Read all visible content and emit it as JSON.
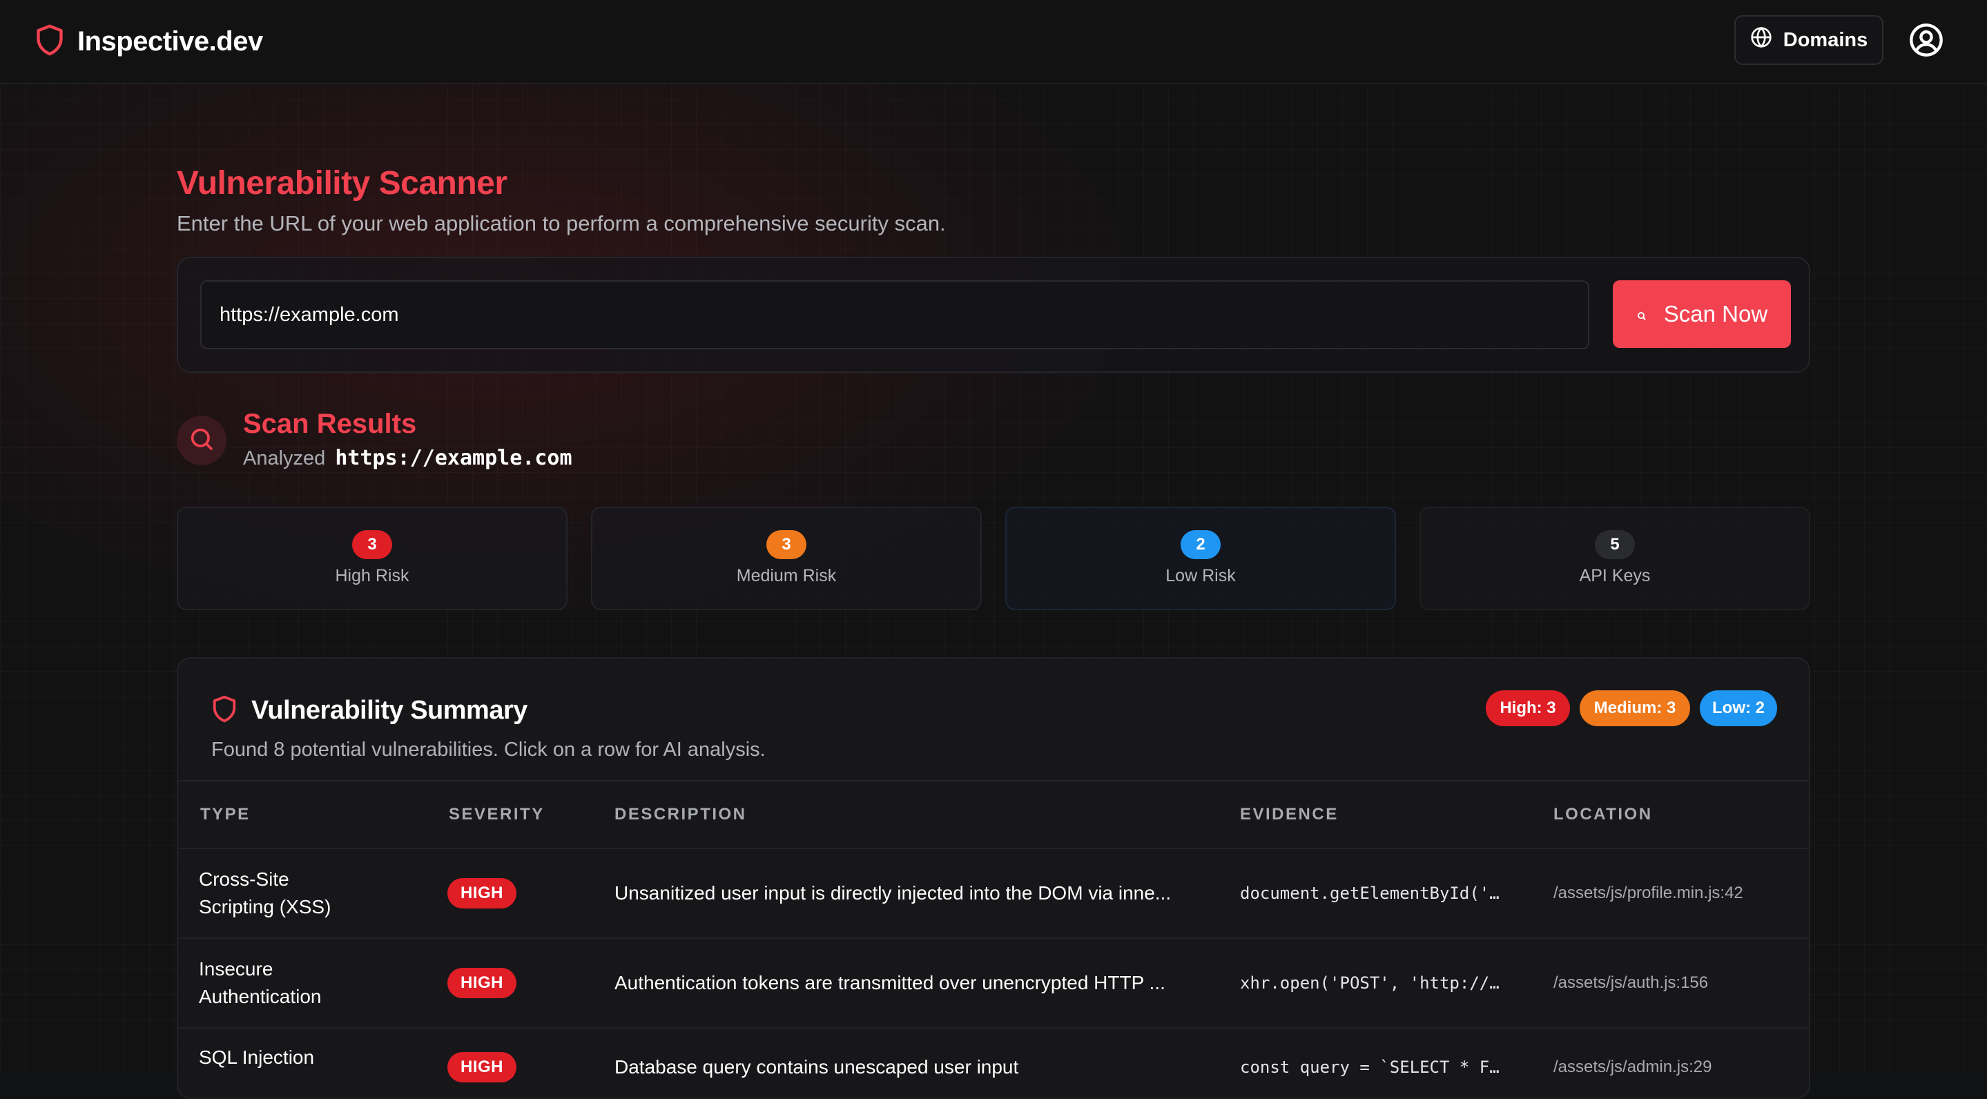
{
  "header": {
    "brand": "Inspective.dev",
    "domains_label": "Domains",
    "icons": {
      "logo": "shield-icon",
      "domains": "globe-icon",
      "user": "user-circle-icon"
    }
  },
  "scanner": {
    "title": "Vulnerability Scanner",
    "subtitle": "Enter the URL of your web application to perform a comprehensive security scan.",
    "url_value": "https://example.com",
    "scan_button": "Scan Now"
  },
  "results": {
    "title": "Scan Results",
    "analyzed_prefix": "Analyzed",
    "analyzed_url": "https://example.com",
    "stats": [
      {
        "count": "3",
        "label": "High Risk",
        "color": "#e01e26"
      },
      {
        "count": "3",
        "label": "Medium Risk",
        "color": "#f0791c"
      },
      {
        "count": "2",
        "label": "Low Risk",
        "color": "#1f96f2"
      },
      {
        "count": "5",
        "label": "API Keys",
        "color": "#2a2b2f"
      }
    ]
  },
  "summary": {
    "title": "Vulnerability Summary",
    "subtitle": "Found 8 potential vulnerabilities. Click on a row for AI analysis.",
    "pills": {
      "high": "High: 3",
      "medium": "Medium: 3",
      "low": "Low: 2"
    },
    "columns": [
      "TYPE",
      "SEVERITY",
      "DESCRIPTION",
      "EVIDENCE",
      "LOCATION"
    ],
    "rows": [
      {
        "type_line1": "Cross-Site",
        "type_line2": "Scripting (XSS)",
        "severity": "HIGH",
        "description": "Unsanitized user input is directly injected into the DOM via inne...",
        "evidence": "document.getElementById('…",
        "location": "/assets/js/profile.min.js:42"
      },
      {
        "type_line1": "Insecure",
        "type_line2": "Authentication",
        "severity": "HIGH",
        "description": "Authentication tokens are transmitted over unencrypted HTTP ...",
        "evidence": "xhr.open('POST', 'http://…",
        "location": "/assets/js/auth.js:156"
      },
      {
        "type_line1": "SQL Injection",
        "type_line2": "",
        "severity": "HIGH",
        "description": "Database query contains unescaped user input",
        "evidence": "const query = `SELECT * F…",
        "location": "/assets/js/admin.js:29"
      }
    ]
  },
  "colors": {
    "accent": "#f2414f",
    "high": "#e01e26",
    "medium": "#f0791c",
    "low": "#1f96f2"
  }
}
